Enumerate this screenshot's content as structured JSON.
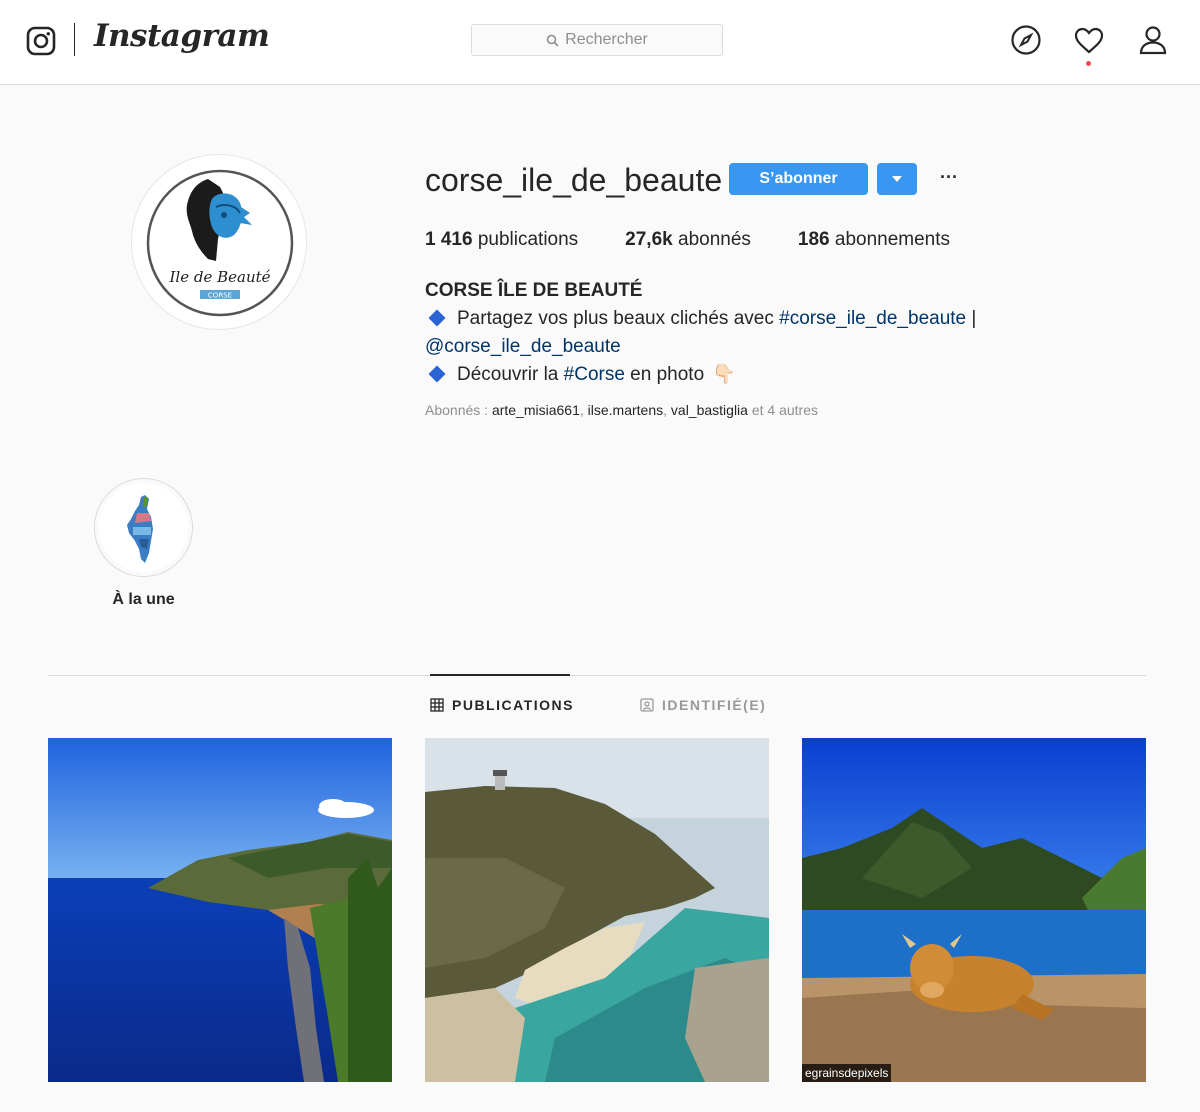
{
  "nav": {
    "wordmark": "Instagram",
    "search_placeholder": "Rechercher",
    "icons": [
      "instagram-glyph-icon",
      "search-icon",
      "compass-icon",
      "heart-icon",
      "user-icon"
    ],
    "notification_dot_color": "#ed4956"
  },
  "profile": {
    "username": "corse_ile_de_beaute",
    "follow_label": "S’abonner",
    "more_label": "···",
    "avatar": {
      "script_text": "Ile de Beauté",
      "badge": "CORSE"
    },
    "stats": [
      {
        "value": "1 416",
        "label": " publications"
      },
      {
        "value": "27,6k",
        "label": " abonnés"
      },
      {
        "value": "186",
        "label": " abonnements"
      }
    ],
    "bio": {
      "name": "CORSE ÎLE DE BEAUTÉ",
      "line1_text": "Partagez vos plus beaux clichés avec ",
      "line1_tag": "#corse_ile_de_beaute",
      "line1_tail": " |",
      "line2_mention": "@corse_ile_de_beaute",
      "line3_text": "Découvrir la ",
      "line3_tag": "#Corse",
      "line3_tail": " en photo",
      "hand_emoji": "👇🏻"
    },
    "followed_by": {
      "prefix": "Abonnés : ",
      "users": [
        "arte_misia661",
        "ilse.martens",
        "val_bastiglia"
      ],
      "suffix": " et 4 autres"
    }
  },
  "highlights": [
    {
      "label": "À la une"
    }
  ],
  "tabs": [
    {
      "label": "PUBLICATIONS",
      "active": true
    },
    {
      "label": "IDENTIFIÉ(E)",
      "active": false
    }
  ],
  "posts": [
    {
      "alt": "coastline-photo"
    },
    {
      "alt": "lighthouse-cliff-photo"
    },
    {
      "alt": "cow-bay-photo",
      "credit": "egrainsdepixels"
    }
  ],
  "colors": {
    "accent": "#3897f0",
    "link": "#003569",
    "border": "#dbdbdb"
  }
}
